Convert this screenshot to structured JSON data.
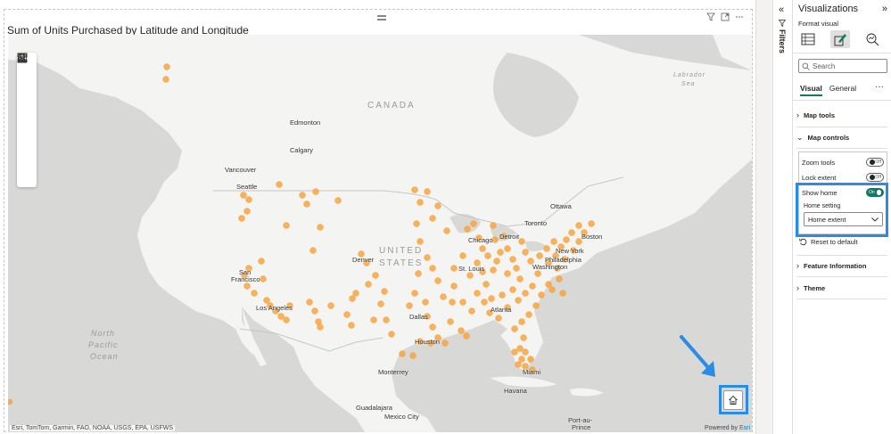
{
  "visual": {
    "title": "Sum of Units Purchased by Latitude and Longitude",
    "header_icons": [
      "filter-icon",
      "focus-mode-icon",
      "more-options-icon"
    ]
  },
  "map": {
    "labels": {
      "canada": "CANADA",
      "us_line1": "UNITED",
      "us_line2": "STATES",
      "labrador_line1": "Labrador",
      "labrador_line2": "Sea",
      "ocean_line1": "North",
      "ocean_line2": "Pacific",
      "ocean_line3": "Ocean",
      "edmonton": "Edmonton",
      "calgary": "Calgary",
      "vancouver": "Vancouver",
      "seattle": "Seattle",
      "san_francisco_line1": "San",
      "san_francisco_line2": "Francisco",
      "los_angeles": "Los Angeles",
      "denver": "Denver",
      "dallas": "Dallas",
      "houston": "Houston",
      "st_louis": "St. Louis",
      "chicago": "Chicago",
      "detroit": "Detroit",
      "toronto": "Toronto",
      "ottawa": "Ottawa",
      "boston": "Boston",
      "new_york": "New York",
      "philadelphia": "Philadelphia",
      "washington": "Washington",
      "atlanta": "Atlanta",
      "miami": "Miami",
      "monterrey": "Monterrey",
      "guadalajara": "Guadalajara",
      "mexico_city": "Mexico City",
      "havana": "Havana",
      "port_au_prince_line1": "Port-au-",
      "port_au_prince_line2": "Prince"
    },
    "tools": [
      "menu-icon",
      "layers-icon",
      "qr-select-icon",
      "select-rect-icon",
      "search-icon",
      "bar-chart-icon",
      "person-icon"
    ],
    "attribution": "Esri, TomTom, Garmin, FAO, NOAA, USGS, EPA, USFWS",
    "powered_prefix": "Powered by ",
    "powered_brand": "Esri",
    "home_button_icon": "home-icon",
    "point_color": "#f7a540"
  },
  "filters_pane": {
    "label": "Filters",
    "collapse_icon": "chevron-double-left-icon"
  },
  "viz_pane": {
    "title": "Visualizations",
    "format_label": "Format visual",
    "search_placeholder": "Search",
    "tabs": [
      "Visual",
      "General"
    ],
    "more": "···",
    "sections": {
      "map_tools": "Map tools",
      "map_controls": "Map controls",
      "feature_information": "Feature Information",
      "theme": "Theme"
    },
    "controls": {
      "zoom_tools": {
        "label": "Zoom tools",
        "state": "Off"
      },
      "lock_extent": {
        "label": "Lock extent",
        "state": "Off"
      },
      "show_home": {
        "label": "Show home",
        "state": "On"
      },
      "home_setting_label": "Home setting",
      "home_setting_value": "Home extent",
      "reset": "Reset to default"
    },
    "accent_color": "#117865",
    "highlight_color": "#2b8ce5"
  }
}
